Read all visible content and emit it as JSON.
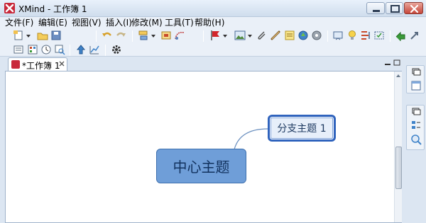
{
  "window": {
    "title": "XMind - 工作簿 1",
    "controls": [
      "minimize-icon",
      "maximize-icon",
      "close-icon"
    ]
  },
  "menu": [
    "文件(F)",
    "编辑(E)",
    "视图(V)",
    "插入(I)",
    "修改(M)",
    "工具(T)",
    "帮助(H)"
  ],
  "toolbar": {
    "row1": [
      "new-workbook-icon",
      "open-icon",
      "save-icon",
      "undo-icon",
      "redo-icon",
      "insert-topic-icon",
      "subtopic-icon",
      "relationship-icon",
      "marker-icon",
      "image-icon",
      "attachment-icon",
      "hyperlink-icon",
      "note-icon",
      "label-icon",
      "audio-icon",
      "presentation-icon",
      "idea-icon",
      "summary-icon",
      "boundary-icon",
      "share-icon",
      "export-icon"
    ],
    "row2": [
      "outline-icon",
      "gallery-icon",
      "history-icon",
      "zoom-fit-icon",
      "upload-icon",
      "chart-icon",
      "settings-icon"
    ]
  },
  "editor_tab": {
    "label": "*工作簿 1",
    "close_icon": "close-icon"
  },
  "mindmap": {
    "central_topic": "中心主题",
    "branch_topic": "分支主题 1",
    "colors": {
      "central_fill": "#6f9ed8",
      "central_border": "#3d6fae",
      "branch_fill": "#e7effa",
      "branch_border": "#2f63bd",
      "connector": "#6a8fbf"
    }
  },
  "right_panel": {
    "icons": [
      "restore-icon",
      "outline-view-icon",
      "restore-icon",
      "properties-icon",
      "zoom-search-icon"
    ]
  }
}
